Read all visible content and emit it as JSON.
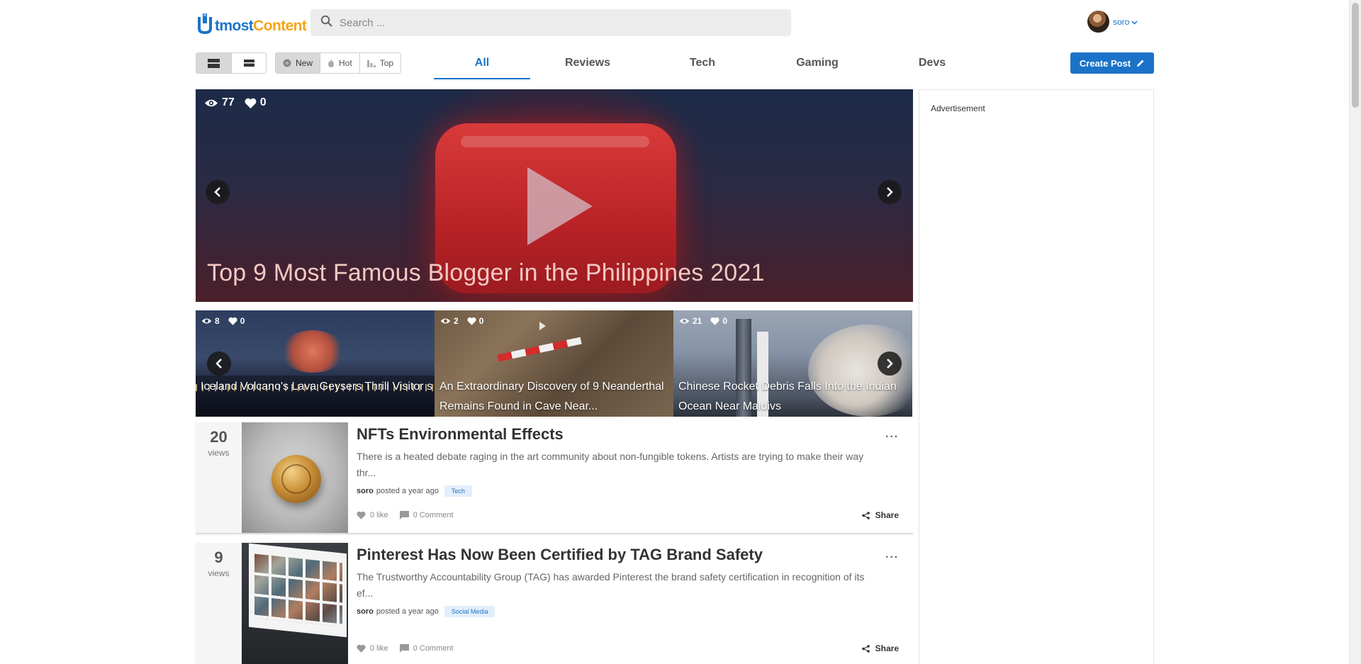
{
  "header": {
    "logo": {
      "part1": "tmost",
      "part2": "Content"
    },
    "search": {
      "placeholder": "Search ..."
    },
    "user": {
      "name": "soro"
    }
  },
  "toolbar": {
    "sort": [
      {
        "label": "New",
        "icon": "new-icon"
      },
      {
        "label": "Hot",
        "icon": "flame-icon"
      },
      {
        "label": "Top",
        "icon": "bar-chart-icon"
      }
    ],
    "tabs": [
      "All",
      "Reviews",
      "Tech",
      "Gaming",
      "Devs"
    ],
    "create_label": "Create Post"
  },
  "hero": {
    "views": "77",
    "likes": "0",
    "title": "Top 9 Most Famous Blogger in the Philippines 2021"
  },
  "carousel": [
    {
      "views": "8",
      "likes": "0",
      "title": "Iceland Volcano's Lava Geysers Thrill Visitor s"
    },
    {
      "views": "2",
      "likes": "0",
      "title": "An Extraordinary Discovery of 9 Neanderthal Remains Found in Cave Near..."
    },
    {
      "views": "21",
      "likes": "0",
      "title": "Chinese Rocket Debris Falls Into the Indian Ocean Near Maldivs"
    }
  ],
  "posts": [
    {
      "views": "20",
      "views_label": "views",
      "title": "NFTs Environmental Effects",
      "excerpt": "There is a heated debate raging in the art community about non-fungible tokens. Artists are trying to make their way thr...",
      "author": "soro",
      "posted": "posted a year ago",
      "tag": "Tech",
      "likes": "0 like",
      "comments": "0 Comment",
      "share": "Share"
    },
    {
      "views": "9",
      "views_label": "views",
      "title": "Pinterest Has Now Been Certified by TAG Brand Safety",
      "excerpt": "The Trustworthy Accountability Group (TAG) has awarded Pinterest the brand safety certification in recognition of its ef...",
      "author": "soro",
      "posted": "posted a year ago",
      "tag": "Social Media",
      "likes": "0 like",
      "comments": "0 Comment",
      "share": "Share"
    }
  ],
  "ad": {
    "label": "Advertisement"
  },
  "colors": {
    "accent": "#1a73c8",
    "logo_orange": "#f5a31a"
  }
}
